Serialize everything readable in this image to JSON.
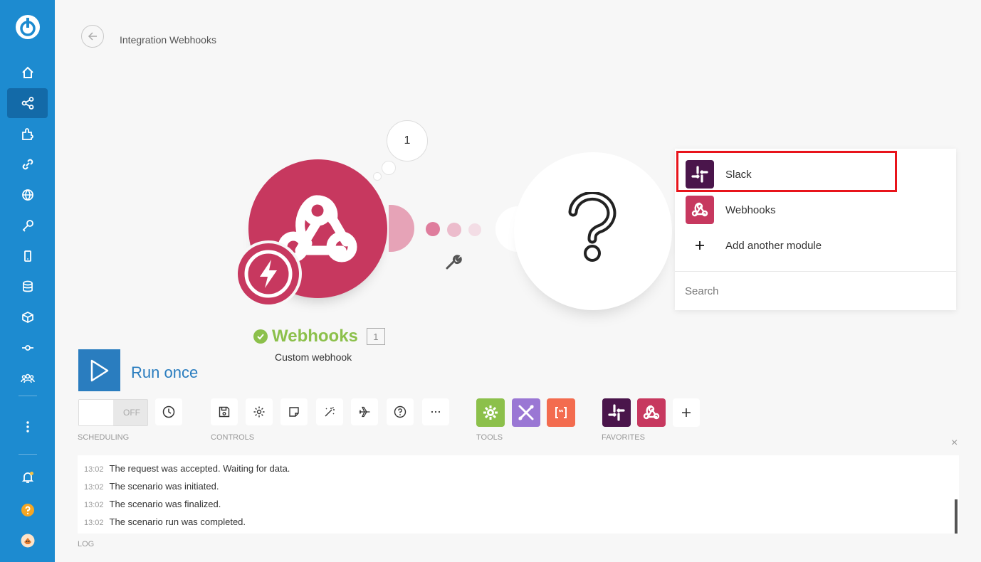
{
  "header": {
    "title": "Integration Webhooks"
  },
  "canvas": {
    "bubble_count": "1",
    "module": {
      "name": "Webhooks",
      "number": "1",
      "subtitle": "Custom webhook"
    }
  },
  "dropdown": {
    "items": [
      {
        "label": "Slack",
        "icon": "slack-icon"
      },
      {
        "label": "Webhooks",
        "icon": "webhooks-icon"
      },
      {
        "label": "Add another module",
        "icon": "plus-icon"
      }
    ],
    "search_placeholder": "Search"
  },
  "run": {
    "label": "Run once"
  },
  "toolbar": {
    "toggle_label": "OFF",
    "sections": {
      "scheduling": "SCHEDULING",
      "controls": "CONTROLS",
      "tools": "TOOLS",
      "favorites": "FAVORITES"
    }
  },
  "log": {
    "label": "LOG",
    "entries": [
      {
        "time": "13:02",
        "text": "The request was accepted. Waiting for data."
      },
      {
        "time": "13:02",
        "text": "The scenario was initiated."
      },
      {
        "time": "13:02",
        "text": "The scenario was finalized."
      },
      {
        "time": "13:02",
        "text": "The scenario run was completed."
      }
    ]
  },
  "colors": {
    "sidebar": "#1d8bd0",
    "webhook": "#c7385f",
    "slack": "#4a154b",
    "success": "#8cc04b",
    "highlight": "#e8141b"
  }
}
